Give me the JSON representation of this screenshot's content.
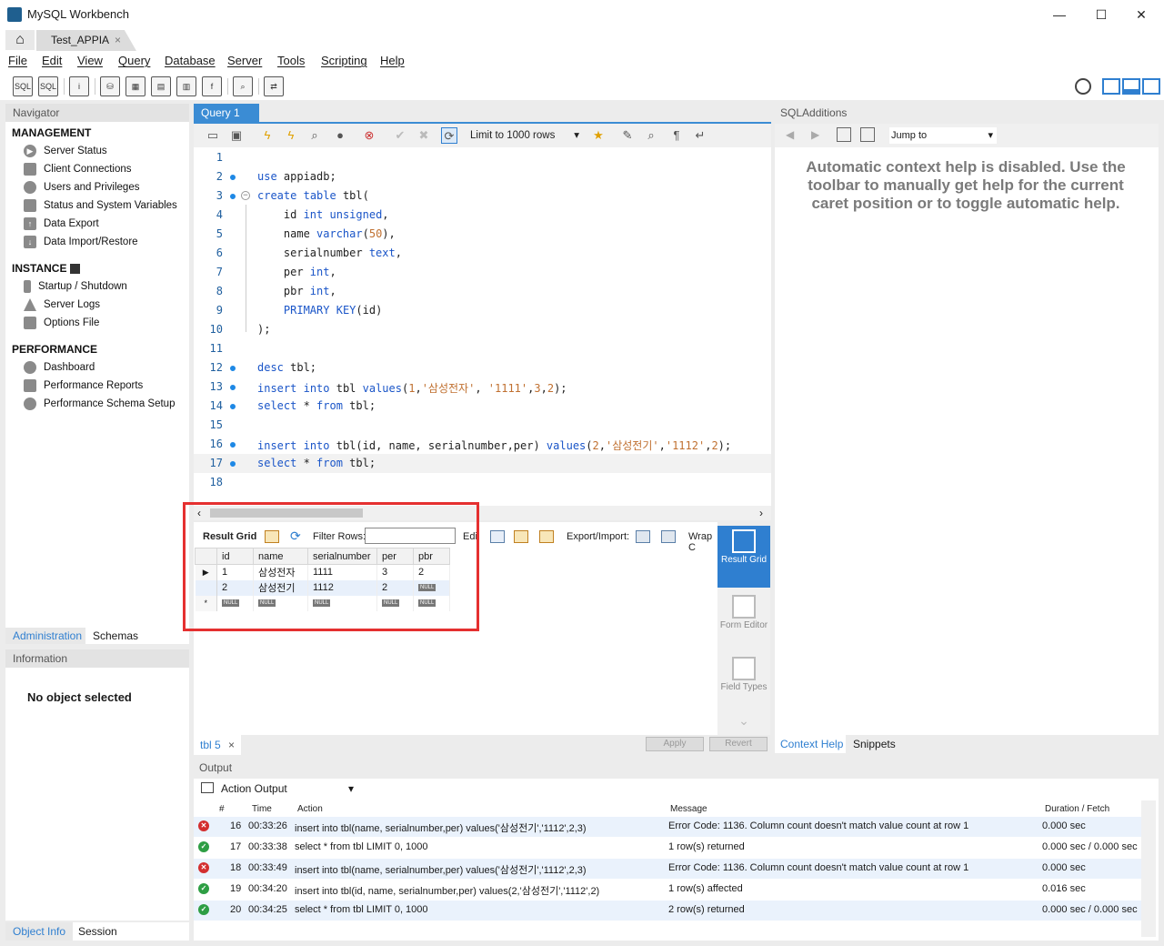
{
  "window": {
    "title": "MySQL Workbench",
    "min": "—",
    "max": "☐",
    "close": "✕"
  },
  "tabs": {
    "connection": "Test_APPIA",
    "close": "×"
  },
  "menu": [
    "File",
    "Edit",
    "View",
    "Query",
    "Database",
    "Server",
    "Tools",
    "Scripting",
    "Help"
  ],
  "navigator": {
    "title": "Navigator",
    "management_title": "MANAGEMENT",
    "management": [
      "Server Status",
      "Client Connections",
      "Users and Privileges",
      "Status and System Variables",
      "Data Export",
      "Data Import/Restore"
    ],
    "instance_title": "INSTANCE",
    "instance": [
      "Startup / Shutdown",
      "Server Logs",
      "Options File"
    ],
    "performance_title": "PERFORMANCE",
    "performance": [
      "Dashboard",
      "Performance Reports",
      "Performance Schema Setup"
    ],
    "tab_admin": "Administration",
    "tab_schemas": "Schemas"
  },
  "information": {
    "title": "Information",
    "message": "No object selected",
    "tab_objinfo": "Object Info",
    "tab_session": "Session"
  },
  "query_tab": {
    "label": "Query 1",
    "close": "×"
  },
  "editor_toolbar": {
    "limit": "Limit to 1000 rows"
  },
  "code": [
    "",
    "use appiadb;",
    "create table tbl(",
    "    id int unsigned,",
    "    name varchar(50),",
    "    serialnumber text,",
    "    per int,",
    "    pbr int,",
    "    PRIMARY KEY(id)",
    ");",
    "",
    "desc tbl;",
    "insert into tbl values(1,'삼성전자', '1111',3,2);",
    "select * from tbl;",
    "",
    "insert into tbl(id, name, serialnumber,per) values(2,'삼성전기','1112',2);",
    "select * from tbl;",
    ""
  ],
  "line_numbers": [
    "1",
    "2",
    "3",
    "4",
    "5",
    "6",
    "7",
    "8",
    "9",
    "10",
    "11",
    "12",
    "13",
    "14",
    "15",
    "16",
    "17",
    "18"
  ],
  "result_toolbar": {
    "result_grid": "Result Grid",
    "filter": "Filter Rows:",
    "edit": "Edi",
    "export": "Export/Import:",
    "wrap": "Wrap C"
  },
  "result_grid": {
    "columns": [
      "id",
      "name",
      "serialnumber",
      "per",
      "pbr"
    ],
    "rows": [
      [
        "1",
        "삼성전자",
        "1111",
        "3",
        "2"
      ],
      [
        "2",
        "삼성전기",
        "1112",
        "2",
        "NULL"
      ]
    ],
    "null_label": "NULL",
    "new_row_marker": "*",
    "current_row_marker": "▶"
  },
  "right_strip": {
    "result_grid": "Result Grid",
    "form_editor": "Form Editor",
    "field_types": "Field Types"
  },
  "result_footer": {
    "tab": "tbl 5",
    "close": "×",
    "apply": "Apply",
    "revert": "Revert"
  },
  "sql_additions": {
    "title": "SQLAdditions",
    "jump_to": "Jump to",
    "help": "Automatic context help is disabled. Use the toolbar to manually get help for the current caret position or to toggle automatic help.",
    "tab_context": "Context Help",
    "tab_snippets": "Snippets"
  },
  "output": {
    "title": "Output",
    "mode": "Action Output",
    "columns": {
      "num": "#",
      "time": "Time",
      "action": "Action",
      "message": "Message",
      "duration": "Duration / Fetch"
    },
    "rows": [
      {
        "status": "error",
        "num": "16",
        "time": "00:33:26",
        "action": "insert into tbl(name, serialnumber,per) values('삼성전기','1112',2,3)",
        "message": "Error Code: 1136. Column count doesn't match value count at row 1",
        "duration": "0.000 sec"
      },
      {
        "status": "ok",
        "num": "17",
        "time": "00:33:38",
        "action": "select * from tbl LIMIT 0, 1000",
        "message": "1 row(s) returned",
        "duration": "0.000 sec / 0.000 sec"
      },
      {
        "status": "error",
        "num": "18",
        "time": "00:33:49",
        "action": "insert into tbl(name, serialnumber,per) values('삼성전기','1112',2,3)",
        "message": "Error Code: 1136. Column count doesn't match value count at row 1",
        "duration": "0.000 sec"
      },
      {
        "status": "ok",
        "num": "19",
        "time": "00:34:20",
        "action": "insert into tbl(id, name, serialnumber,per) values(2,'삼성전기','1112',2)",
        "message": "1 row(s) affected",
        "duration": "0.016 sec"
      },
      {
        "status": "ok",
        "num": "20",
        "time": "00:34:25",
        "action": "select * from tbl LIMIT 0, 1000",
        "message": "2 row(s) returned",
        "duration": "0.000 sec / 0.000 sec"
      }
    ]
  },
  "colors": {
    "accent": "#3b8cd4",
    "error": "#d32f2f",
    "ok": "#2e9e44",
    "highlight": "#e53030"
  }
}
